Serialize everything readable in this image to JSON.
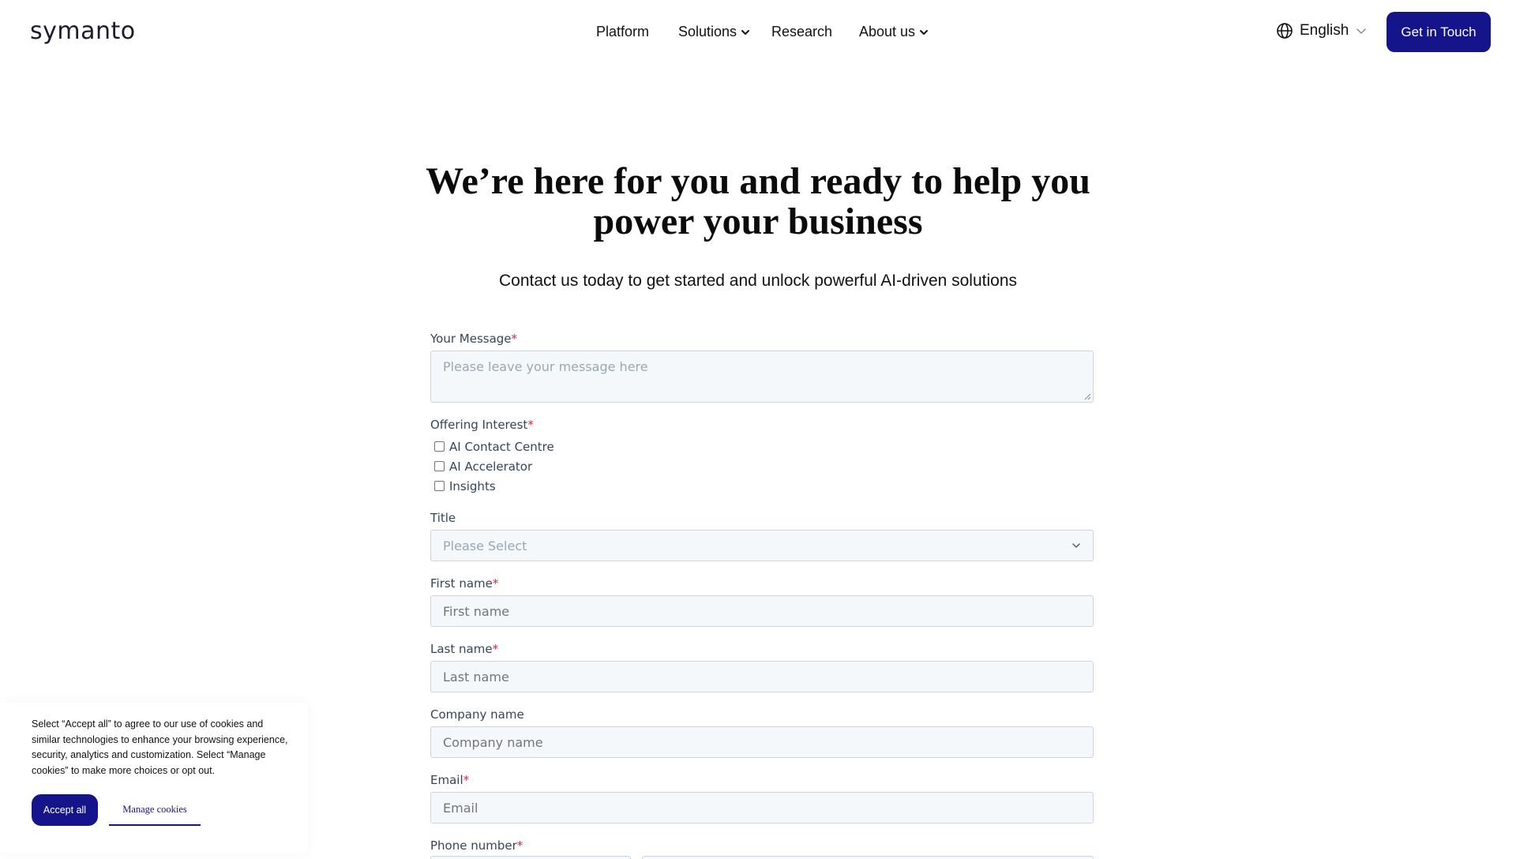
{
  "header": {
    "logo": "symanto",
    "nav": [
      {
        "label": "Platform",
        "has_dropdown": false
      },
      {
        "label": "Solutions",
        "has_dropdown": true
      },
      {
        "label": "Research",
        "has_dropdown": false
      },
      {
        "label": "About us",
        "has_dropdown": true
      }
    ],
    "language": "English",
    "cta_label": "Get in Touch"
  },
  "hero": {
    "title_line1": "We’re here for you and ready to help you",
    "title_line2": "power your business",
    "subtitle": "Contact us today to get started and unlock powerful AI-driven solutions"
  },
  "form": {
    "message": {
      "label": "Your Message",
      "required": "*",
      "placeholder": "Please leave your message here"
    },
    "offering": {
      "label": "Offering Interest",
      "required": "*",
      "options": [
        "AI Contact Centre",
        "AI Accelerator",
        "Insights"
      ]
    },
    "title": {
      "label": "Title",
      "selected": "Please Select"
    },
    "first_name": {
      "label": "First name",
      "required": "*",
      "placeholder": "First name"
    },
    "last_name": {
      "label": "Last name",
      "required": "*",
      "placeholder": "Last name"
    },
    "company": {
      "label": "Company name",
      "placeholder": "Company name"
    },
    "email": {
      "label": "Email",
      "required": "*",
      "placeholder": "Email"
    },
    "phone": {
      "label": "Phone number",
      "required": "*"
    }
  },
  "cookie": {
    "text": "Select “Accept all” to agree to our use of cookies and similar technologies to enhance your browsing experience, security, analytics and customization. Select “Manage cookies” to make more choices or opt out.",
    "accept_label": "Accept all",
    "manage_label": "Manage cookies"
  },
  "colors": {
    "brand": "#15148a",
    "required": "#e0243a",
    "input_bg": "#f5f8fa",
    "input_border": "#cbd6e2"
  },
  "icons": {
    "language": "globe-icon",
    "dropdown": "chevron-down-icon"
  }
}
